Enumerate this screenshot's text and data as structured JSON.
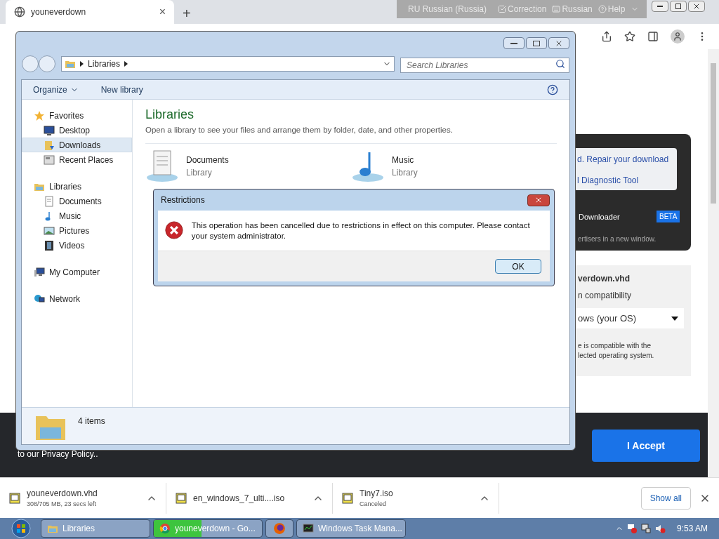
{
  "browser": {
    "tab_title": "youneverdown",
    "close_tab": "×",
    "new_tab": "+"
  },
  "language_bar": {
    "language": "RU Russian (Russia)",
    "items": [
      "Correction",
      "Russian",
      "Help"
    ]
  },
  "explorer": {
    "address": [
      "Libraries"
    ],
    "search": {
      "placeholder": "Search Libraries"
    },
    "toolbar": [
      "Organize",
      "New library"
    ],
    "nav": [
      {
        "label": "Favorites",
        "kind": "star",
        "selected": false,
        "children": [
          {
            "label": "Desktop",
            "kind": "desktop",
            "selected": false
          },
          {
            "label": "Downloads",
            "kind": "download",
            "selected": true
          },
          {
            "label": "Recent Places",
            "kind": "recent",
            "selected": false
          }
        ]
      },
      {
        "label": "Libraries",
        "kind": "library",
        "selected": false,
        "children": [
          {
            "label": "Documents",
            "kind": "document",
            "selected": false
          },
          {
            "label": "Music",
            "kind": "music",
            "selected": false
          },
          {
            "label": "Pictures",
            "kind": "picture",
            "selected": false
          },
          {
            "label": "Videos",
            "kind": "video",
            "selected": false
          }
        ]
      },
      {
        "label": "My Computer",
        "kind": "computer",
        "selected": false
      },
      {
        "label": "Network",
        "kind": "network",
        "selected": false
      }
    ],
    "heading": "Libraries",
    "subtitle": "Open a library to see your files and arrange them by folder, date, and other properties.",
    "libraries": [
      {
        "name": "Documents",
        "type": "Library",
        "kind": "document"
      },
      {
        "name": "Music",
        "type": "Library",
        "kind": "music"
      }
    ],
    "status": "4 items"
  },
  "dialog": {
    "title": "Restrictions",
    "message": "This operation has been cancelled due to restrictions in effect on this computer. Please contact your system administrator.",
    "button": "OK"
  },
  "webpage": {
    "links": [
      "d. Repair your download",
      "l Diagnostic Tool"
    ],
    "downloader": "Downloader",
    "badge": "BETA",
    "note": "ertisers in a new window.",
    "file": "verdown.vhd",
    "compat": "n compatibility",
    "os_select": "ows (your OS)",
    "compat_note": [
      "e is compatible with the",
      "lected operating system."
    ],
    "privacy": "to our Privacy Policy..",
    "accept": "I Accept"
  },
  "downloads": [
    {
      "name": "youneverdown.vhd",
      "status": "308/705 MB, 23 secs left"
    },
    {
      "name": "en_windows_7_ulti....iso"
    },
    {
      "name": "Tiny7.iso",
      "status": "Canceled"
    }
  ],
  "show_all": "Show all",
  "taskbar": {
    "items": [
      {
        "label": "Libraries",
        "kind": "folder"
      },
      {
        "label": "youneverdown - Go...",
        "kind": "chrome",
        "level": 0.44
      },
      {
        "kind": "firefox"
      },
      {
        "label": "Windows Task Mana...",
        "kind": "monitor"
      }
    ],
    "clock": "9:53 AM"
  }
}
